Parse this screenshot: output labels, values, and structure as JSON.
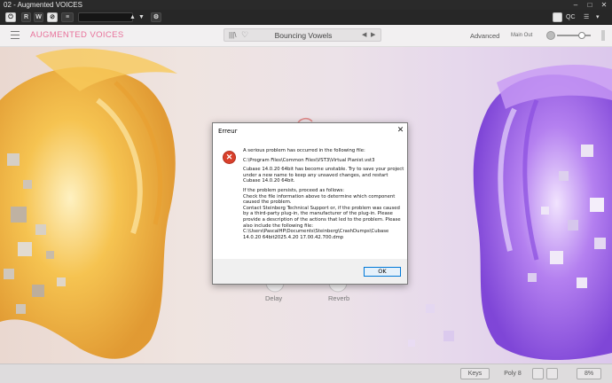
{
  "window": {
    "title": "02 - Augmented VOICES",
    "minimize_label": "–",
    "maximize_label": "□",
    "close_label": "✕"
  },
  "hostbar": {
    "power_label": "⏻",
    "read_label": "R",
    "write_label": "W",
    "bypass_label": "⊘",
    "menu_label": "≡",
    "prev_label": "▲",
    "next_label": "▼",
    "options_label": "⚙",
    "right_labels": [
      "QC",
      "☰",
      "▾"
    ]
  },
  "plugin": {
    "brand": "AUGMENTED VOICES",
    "preset_name": "Bouncing Vowels",
    "library_icon": "|||\\",
    "heart_icon": "♡",
    "preset_prev": "◀",
    "preset_next": "▶",
    "advanced_label": "Advanced",
    "main_out_label": "Main Out"
  },
  "knobs": {
    "delay_label": "Delay",
    "reverb_label": "Reverb"
  },
  "statusbar": {
    "keys_label": "Keys",
    "poly_label": "Poly 8",
    "zoom_label": "8%"
  },
  "dialog": {
    "title": "Erreur",
    "close_label": "✕",
    "icon": "✕",
    "paragraphs": [
      "A serious problem has occurred in the following file:",
      "C:\\Program Files\\Common Files\\VST3\\Virtual Pianist.vst3",
      "Cubase 14.0.20 64bit has become unstable. Try to save your project under a new name to keep any unsaved changes, and restart Cubase 14.0.20 64bit.",
      "If the problem persists, proceed as follows:\nCheck the file information above to determine which component caused the problem.\nContact Steinberg Technical Support or, if the problem was caused by a third-party plug-in, the manufacturer of the plug-in. Please provide a description of the actions that led to the problem. Please also include the following file:\nC:\\Users\\PascalHP\\Documents\\Steinberg\\CrashDumps\\Cubase 14.0.20 64bit2025.4.20 17.00.42.700.dmp"
    ],
    "ok_label": "OK"
  },
  "colors": {
    "brand_pink": "#e8719a",
    "error_red": "#d9402b",
    "accent_blue": "#0078d7"
  }
}
